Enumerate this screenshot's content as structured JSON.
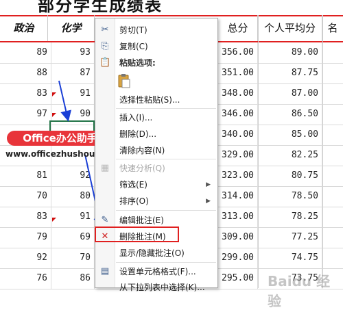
{
  "title": "部分学生成绩表",
  "headers": [
    "政治",
    "化学",
    "总分",
    "个人平均分",
    "名"
  ],
  "rows": [
    {
      "zhengzhi": "89",
      "huaxue": "93",
      "zongfen": "356.00",
      "pingjun": "89.00"
    },
    {
      "zhengzhi": "88",
      "huaxue": "87",
      "zongfen": "351.00",
      "pingjun": "87.75"
    },
    {
      "zhengzhi": "83",
      "huaxue": "91",
      "zongfen": "348.00",
      "pingjun": "87.00"
    },
    {
      "zhengzhi": "97",
      "huaxue": "90",
      "zongfen": "346.00",
      "pingjun": "86.50"
    },
    {
      "zhengzhi": "",
      "huaxue": "",
      "zongfen": "340.00",
      "pingjun": "85.00"
    },
    {
      "zhengzhi": "",
      "huaxue": "",
      "zongfen": "329.00",
      "pingjun": "82.25"
    },
    {
      "zhengzhi": "81",
      "huaxue": "92",
      "zongfen": "323.00",
      "pingjun": "80.75"
    },
    {
      "zhengzhi": "70",
      "huaxue": "80",
      "zongfen": "314.00",
      "pingjun": "78.50"
    },
    {
      "zhengzhi": "83",
      "huaxue": "91",
      "zongfen": "313.00",
      "pingjun": "78.25"
    },
    {
      "zhengzhi": "79",
      "huaxue": "69",
      "zongfen": "309.00",
      "pingjun": "77.25"
    },
    {
      "zhengzhi": "92",
      "huaxue": "70",
      "zongfen": "299.00",
      "pingjun": "74.75"
    },
    {
      "zhengzhi": "76",
      "huaxue": "86",
      "zongfen": "295.00",
      "pingjun": "73.75"
    }
  ],
  "menu": {
    "cut": "剪切(T)",
    "copy": "复制(C)",
    "paste_options": "粘贴选项:",
    "paste_special": "选择性粘贴(S)...",
    "insert": "插入(I)...",
    "delete": "删除(D)...",
    "clear": "清除内容(N)",
    "quick_analysis": "快速分析(Q)",
    "filter": "筛选(E)",
    "sort": "排序(O)",
    "edit_comment": "编辑批注(E)",
    "delete_comment": "删除批注(M)",
    "show_hide_comment": "显示/隐藏批注(O)",
    "format_cells": "设置单元格格式(F)...",
    "pick_from_list": "从下拉列表中选择(K)..."
  },
  "watermark": {
    "badge": "Office办公助手",
    "url": "www.officezhushou.com",
    "baidu": "Baidu 经验"
  },
  "colors": {
    "accent_red": "#e02020",
    "arrow_blue": "#1a3fd6",
    "badge_red": "#e8343a"
  }
}
